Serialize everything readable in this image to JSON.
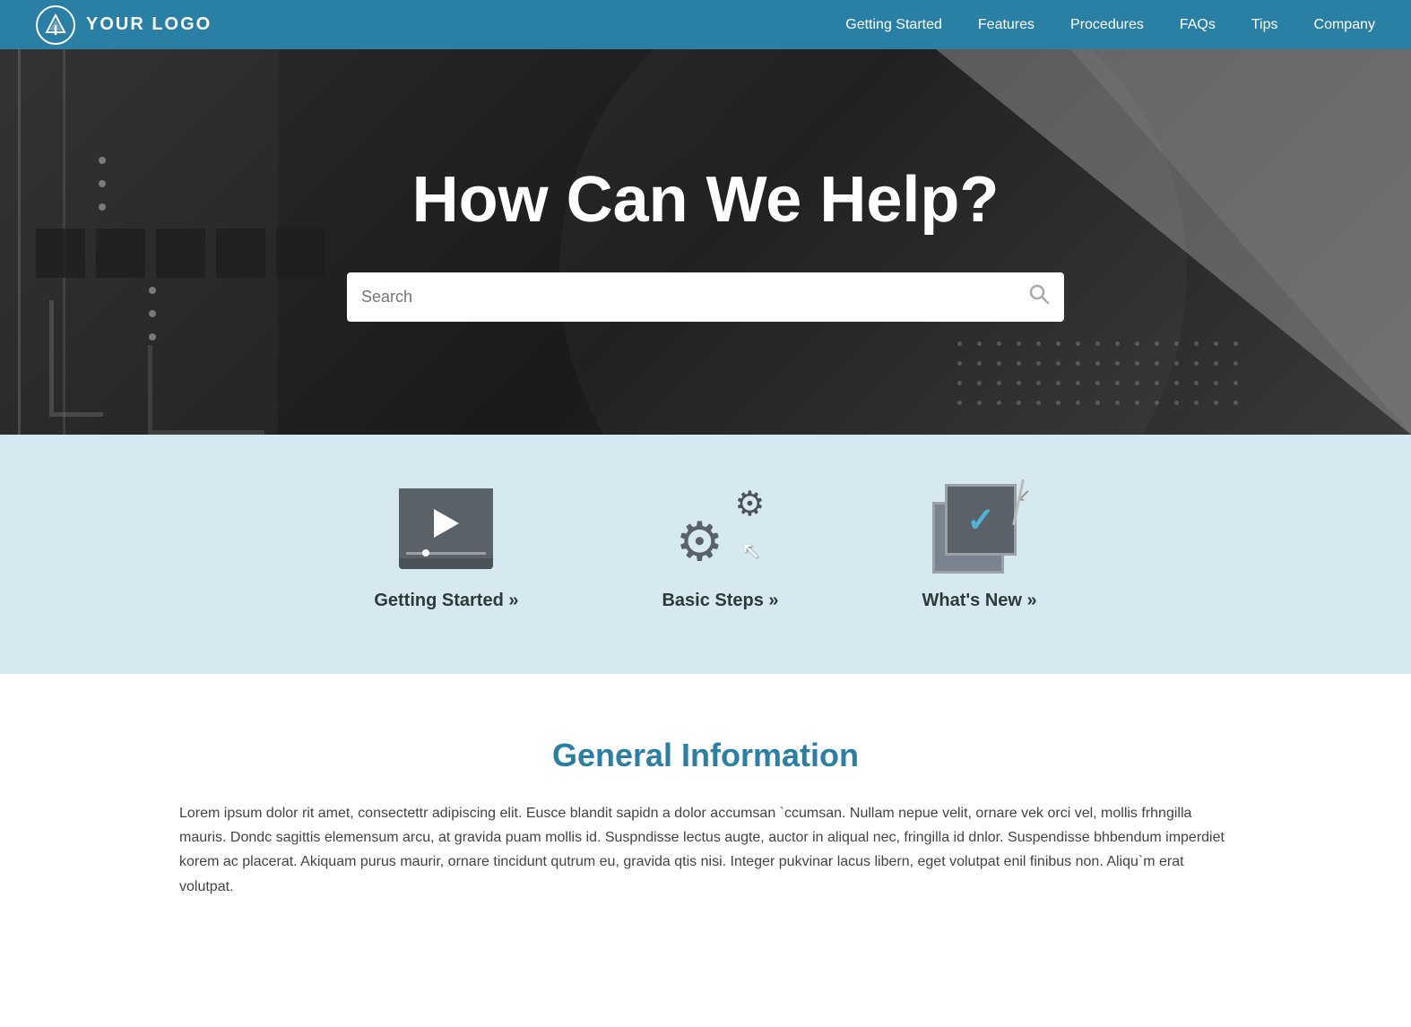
{
  "navbar": {
    "logo_text": "YOUR LOGO",
    "nav_links": [
      {
        "label": "Getting Started",
        "href": "#"
      },
      {
        "label": "Features",
        "href": "#"
      },
      {
        "label": "Procedures",
        "href": "#"
      },
      {
        "label": "FAQs",
        "href": "#"
      },
      {
        "label": "Tips",
        "href": "#"
      },
      {
        "label": "Company",
        "href": "#"
      }
    ]
  },
  "hero": {
    "title": "How Can We Help?",
    "search_placeholder": "Search"
  },
  "cards": [
    {
      "id": "getting-started",
      "label": "Getting Started »"
    },
    {
      "id": "basic-steps",
      "label": "Basic Steps »"
    },
    {
      "id": "whats-new",
      "label": "What's New »"
    }
  ],
  "general": {
    "title": "General Information",
    "body": "Lorem ipsum dolor rit amet, consectettr adipiscing elit. Eusce blandit sapidn a dolor accumsan `ccumsan. Nullam nepue velit, ornare vek orci vel, mollis frhngilla mauris. Dondc sagittis elemensum arcu, at gravida puam mollis id. Suspndisse lectus augte, auctor in aliqual nec, fringilla id dnlor. Suspendisse bhbendum imperdiet korem ac placerat. Akiquam purus maurir, ornare tincidunt qutrum eu, gravida qtis nisi. Integer pukvinar lacus libern, eget volutpat enil finibus non. Aliqu`m erat volutpat."
  }
}
